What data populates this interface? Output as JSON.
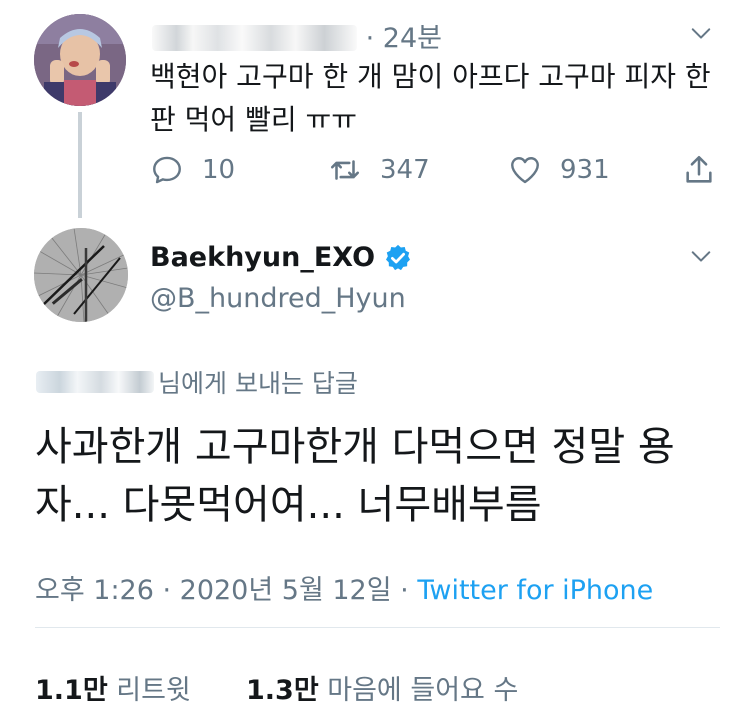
{
  "reply_tweet": {
    "time": "24분",
    "text": "백현아 고구마 한 개 맘이 아프다 고구마 피자 한 판 먹어 빨리 ㅠㅠ",
    "actions": {
      "reply_count": "10",
      "retweet_count": "347",
      "like_count": "931"
    }
  },
  "main_tweet": {
    "display_name": "Baekhyun_EXO",
    "handle": "@B_hundred_Hyun",
    "reply_to_suffix": "님에게 보내는 답글",
    "text": "사과한개 고구마한개 다먹으면 정말 용자... 다못먹어여... 너무배부름",
    "timestamp": "오후 1:26 · 2020년 5월 12일",
    "separator": "·",
    "source": "Twitter for iPhone",
    "stats": {
      "retweets_value": "1.1만",
      "retweets_label": "리트윗",
      "likes_value": "1.3만",
      "likes_label": "마음에 들어요 수"
    }
  },
  "colors": {
    "accent": "#1da1f2",
    "secondary_text": "#657786",
    "primary_text": "#14171a"
  }
}
